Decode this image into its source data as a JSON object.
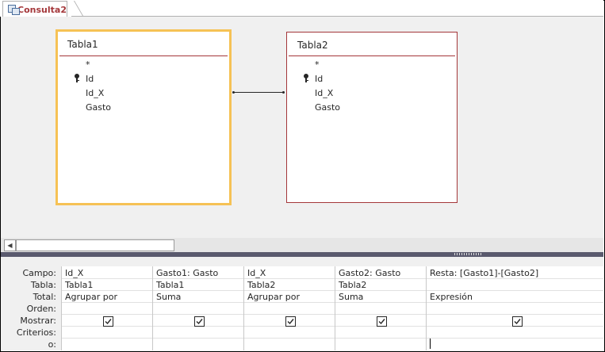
{
  "tab": {
    "label": "Consulta2",
    "icon": "query-icon"
  },
  "tables": [
    {
      "name": "Tabla1",
      "fields": [
        "*",
        "Id",
        "Id_X",
        "Gasto"
      ],
      "key_field": "Id",
      "selected": true
    },
    {
      "name": "Tabla2",
      "fields": [
        "*",
        "Id",
        "Id_X",
        "Gasto"
      ],
      "key_field": "Id",
      "selected": false
    }
  ],
  "grid": {
    "row_labels": [
      "Campo:",
      "Tabla:",
      "Total:",
      "Orden:",
      "Mostrar:",
      "Criterios:",
      "o:"
    ],
    "columns": [
      {
        "campo": "Id_X",
        "tabla": "Tabla1",
        "total": "Agrupar por",
        "orden": "",
        "mostrar": true
      },
      {
        "campo": "Gasto1: Gasto",
        "tabla": "Tabla1",
        "total": "Suma",
        "orden": "",
        "mostrar": true
      },
      {
        "campo": "Id_X",
        "tabla": "Tabla2",
        "total": "Agrupar por",
        "orden": "",
        "mostrar": true
      },
      {
        "campo": "Gasto2: Gasto",
        "tabla": "Tabla2",
        "total": "Suma",
        "orden": "",
        "mostrar": true
      },
      {
        "campo": "Resta: [Gasto1]-[Gasto2]",
        "tabla": "",
        "total": "Expresión",
        "orden": "",
        "mostrar": true
      }
    ]
  },
  "colors": {
    "accent": "#a4373a",
    "selection": "#f6c255",
    "pane_bg": "#f0f0f0"
  }
}
